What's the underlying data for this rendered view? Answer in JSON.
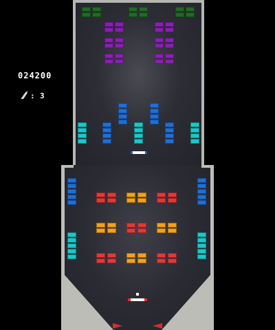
{
  "hud": {
    "score": "024200",
    "lives_separator": ":",
    "lives": "3",
    "life_icon": "rocket-icon"
  },
  "colors": {
    "green": "#1f6b24",
    "purple": "#8a1fb3",
    "blue": "#1f6fd6",
    "cyan": "#19c9c9",
    "red": "#e33838",
    "orange": "#f2a11a",
    "paddle_red": "#e02a2a",
    "wall": "#b9b9b4",
    "floor": "#2a2a33"
  }
}
